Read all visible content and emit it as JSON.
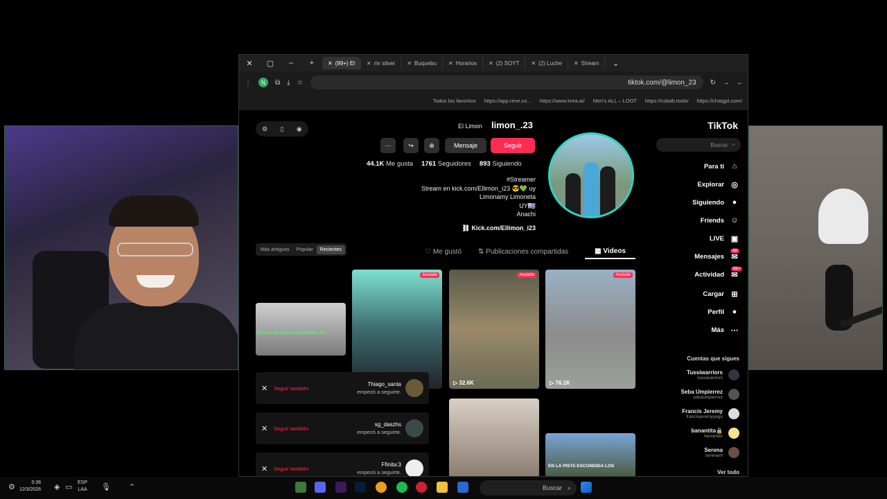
{
  "browser": {
    "tabs": [
      {
        "label": "Stream"
      },
      {
        "label": "(2) Luche"
      },
      {
        "label": "(2) SOYT"
      },
      {
        "label": "Horarios"
      },
      {
        "label": "Buquebu"
      },
      {
        "label": "mr stiver"
      },
      {
        "label": "(99+) El"
      }
    ],
    "url": "tiktok.com/@limon_23",
    "profile_initial": "N",
    "bookmarks": [
      "https://chatgpt.com/",
      "https://cobalt.tools/",
      "Men's ALL – LOOT",
      "https://www.krea.ai/",
      "https://app.reve.co...",
      "Todos los favoritos"
    ]
  },
  "tiktok": {
    "logo": "TikTok",
    "search_placeholder": "Buscar",
    "nav": [
      {
        "label": "Para ti",
        "icon": "home-icon"
      },
      {
        "label": "Explorar",
        "icon": "compass-icon"
      },
      {
        "label": "Siguiendo",
        "icon": "following-icon"
      },
      {
        "label": "Friends",
        "icon": "friends-icon"
      },
      {
        "label": "LIVE",
        "icon": "live-icon"
      },
      {
        "label": "Mensajes",
        "icon": "message-icon",
        "badge": "80"
      },
      {
        "label": "Actividad",
        "icon": "activity-icon",
        "badge": "99+"
      },
      {
        "label": "Cargar",
        "icon": "upload-icon"
      },
      {
        "label": "Perfil",
        "icon": "profile-icon"
      },
      {
        "label": "Más",
        "icon": "more-icon"
      }
    ],
    "following_title": "Cuentas que sigues",
    "following": [
      {
        "name": "Tussiwarriors",
        "handle": "tussiwarriors"
      },
      {
        "name": "Seba Umpierrez",
        "handle": "sebaumpierrez"
      },
      {
        "name": "Francis Jeremy",
        "handle": "francisjeremyyago"
      },
      {
        "name": "banantita🔒",
        "handle": "banantax"
      },
      {
        "name": "Serena",
        "handle": "serenam"
      }
    ],
    "see_all": "Ver todo"
  },
  "profile": {
    "username": "limon_.23",
    "nickname": "El Limon",
    "follow": "Seguir",
    "message": "Mensaje",
    "following_count": "893",
    "following_label": "Siguiendo",
    "followers_count": "1761",
    "followers_label": "Seguidores",
    "likes_count": "44.1K",
    "likes_label": "Me gusta",
    "bio": [
      "#Streamer",
      "Stream en kick.com/Ellimon_i23 😎💚 uy",
      "Limonamy Limoneta",
      "UY🇺🇾",
      "Anachi"
    ],
    "link": "Kick.com/Ellimon_i23"
  },
  "content_tabs": {
    "videos": "Videos",
    "reposts": "Publicaciones compartidas",
    "likes": "Me gustó"
  },
  "sort": {
    "recent": "Recientes",
    "popular": "Popular",
    "oldest": "Más antiguos"
  },
  "videos": [
    {
      "pinned": "Anclado",
      "views": "76.1K"
    },
    {
      "pinned": "Anclado",
      "views": "32.6K"
    },
    {
      "pinned": "Anclado",
      "views": ""
    },
    {
      "overlay": "Stream en kick.com/Ellimon_i23"
    },
    {
      "overlay": ""
    },
    {
      "overlay": "EN LA PISTA ESCONDIDA LOS"
    }
  ],
  "notifications": [
    {
      "user": "Thiago_santa",
      "text": "empezó a seguirte.",
      "action": "Seguir también"
    },
    {
      "user": "sg_daszhs",
      "text": "empezó a seguirte.",
      "action": "Seguir también"
    },
    {
      "user": "Ffinita:3",
      "text": "empezó a seguirte.",
      "action": "Seguir también"
    }
  ],
  "taskbar": {
    "time": "0:36",
    "date": "12/3/2026",
    "lang_top": "ESP",
    "lang_bottom": "LAA",
    "search": "Buscar"
  }
}
